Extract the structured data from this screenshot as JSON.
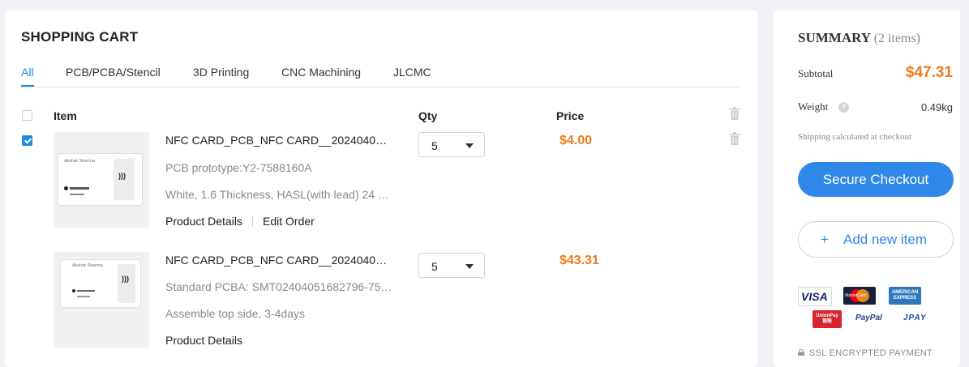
{
  "cart": {
    "title": "SHOPPING CART",
    "tabs": [
      {
        "label": "All",
        "active": true
      },
      {
        "label": "PCB/PCBA/Stencil"
      },
      {
        "label": "3D Printing"
      },
      {
        "label": "CNC Machining"
      },
      {
        "label": "JLCMC"
      }
    ],
    "columns": {
      "item": "Item",
      "qty": "Qty",
      "price": "Price"
    },
    "select_all_checked": false,
    "items": [
      {
        "checked": true,
        "name": "NFC CARD_PCB_NFC CARD__2024040…",
        "meta1": "PCB prototype:Y2-7588160A",
        "meta2": "White, 1.6 Thickness, HASL(with lead) 24 …",
        "link1": "Product Details",
        "link2": "Edit Order",
        "qty": "5",
        "price": "$4.00",
        "card_name": "Akshat Sharma",
        "card_nfc": ")))"
      },
      {
        "checked": false,
        "name": "NFC CARD_PCB_NFC CARD__2024040…",
        "meta1": "Standard PCBA: SMT02404051682796-75…",
        "meta2": "Assemble top side, 3-4days",
        "link1": "Product Details",
        "qty": "5",
        "price": "$43.31",
        "card_name": "Akshat Sharma",
        "card_nfc": ")))"
      }
    ]
  },
  "summary": {
    "title": "SUMMARY",
    "count": "(2 items)",
    "subtotal_label": "Subtotal",
    "subtotal_value": "$47.31",
    "weight_label": "Weight",
    "weight_value": "0.49kg",
    "help_glyph": "?",
    "shipping_note": "Shipping calculated at checkout",
    "checkout_label": "Secure Checkout",
    "add_item_label": "Add new item",
    "add_item_icon": "+",
    "payment_methods": [
      "VISA",
      "MasterCard",
      "AMERICAN EXPRESS",
      "UnionPay 银联",
      "PayPal",
      "JPAY"
    ],
    "ssl_text": "SSL ENCRYPTED PAYMENT",
    "accent_color": "#2f88e8",
    "price_color": "#f27a1a"
  }
}
